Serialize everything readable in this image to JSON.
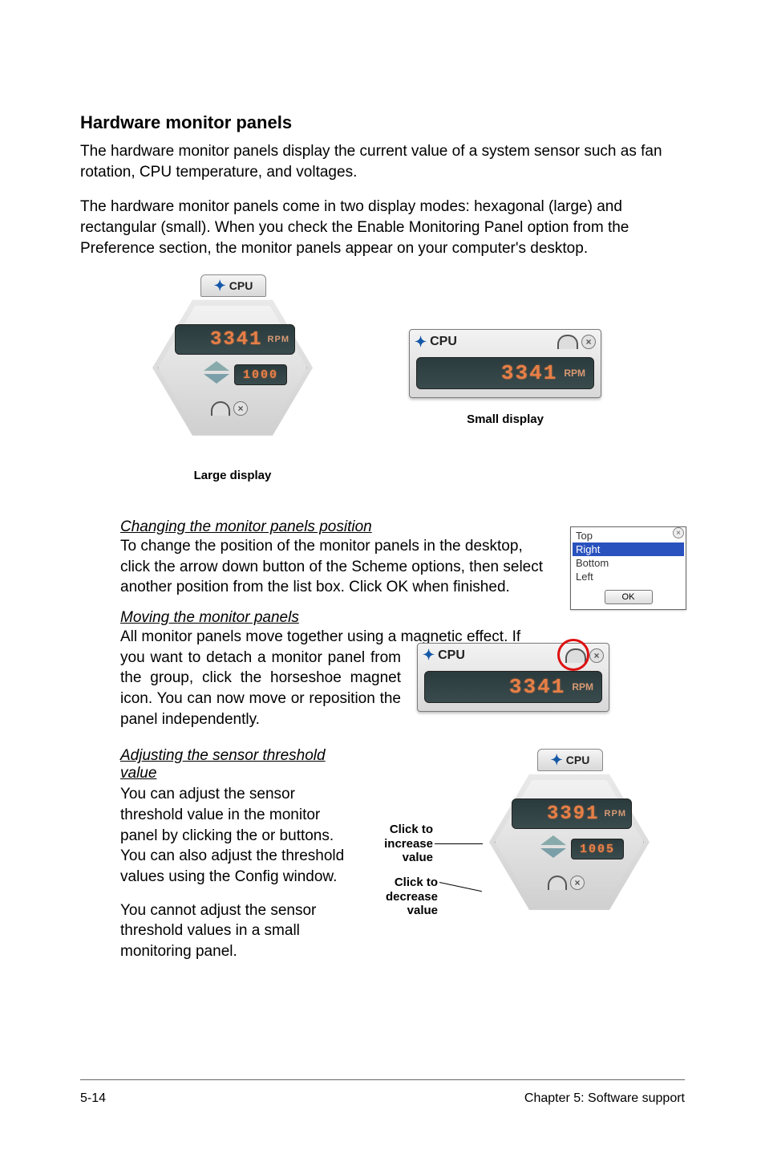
{
  "heading": "Hardware monitor panels",
  "intro1": "The hardware monitor panels display the current value of a system sensor such as fan rotation, CPU temperature, and voltages.",
  "intro2": "The hardware monitor panels come in two display modes: hexagonal (large) and rectangular (small). When you check the Enable Monitoring Panel option from the Preference section, the monitor panels appear on your computer's desktop.",
  "large_panel": {
    "label": "CPU",
    "reading": "3341",
    "unit": "RPM",
    "threshold": "1000",
    "caption": "Large display"
  },
  "small_panel": {
    "label": "CPU",
    "reading": "3341",
    "unit": "RPM",
    "caption": "Small display"
  },
  "changing_position": {
    "heading": "Changing the monitor panels position",
    "text": "To change the position of the monitor panels in the desktop, click the arrow down button of the Scheme options, then select another position from the list box. Click OK when finished.",
    "list": {
      "items": [
        "Top",
        "Right",
        "Bottom",
        "Left"
      ],
      "selected_index": 1,
      "ok_label": "OK"
    }
  },
  "moving_panels": {
    "heading": "Moving the monitor panels",
    "line1": "All monitor panels move together using a magnetic effect. If",
    "line2": "you want to detach a monitor panel from the group, click the horseshoe magnet icon. You can now move or reposition the panel independently.",
    "panel": {
      "label": "CPU",
      "reading": "3341",
      "unit": "RPM"
    }
  },
  "adjusting_threshold": {
    "heading": "Adjusting the sensor threshold value",
    "para1": "You can adjust the sensor threshold value in the monitor panel by clicking the  or  buttons. You can also adjust the threshold values using the Config window.",
    "para2": "You cannot adjust the sensor threshold values in a small monitoring panel.",
    "panel": {
      "label": "CPU",
      "reading": "3391",
      "unit": "RPM",
      "threshold": "1005"
    },
    "annot_increase": "Click to increase value",
    "annot_decrease": "Click to decrease value"
  },
  "footer": {
    "left": "5-14",
    "right": "Chapter 5: Software support"
  }
}
